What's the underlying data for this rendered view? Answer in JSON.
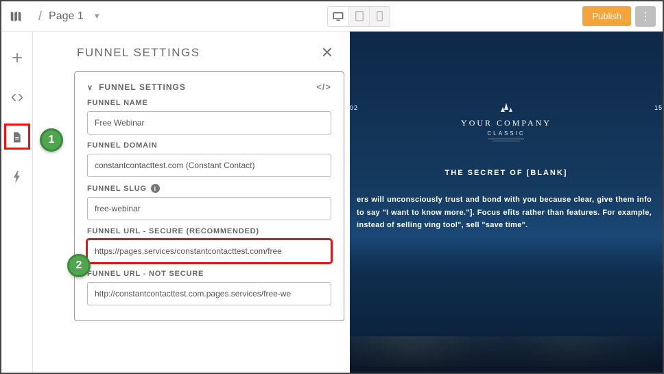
{
  "breadcrumb": {
    "page": "Page 1"
  },
  "topbar": {
    "publish_label": "Publish"
  },
  "panel": {
    "title": "FUNNEL SETTINGS",
    "section_title": "FUNNEL SETTINGS",
    "funnel_name_label": "FUNNEL NAME",
    "funnel_name_value": "Free Webinar",
    "funnel_domain_label": "FUNNEL DOMAIN",
    "funnel_domain_value": "constantcontacttest.com (Constant Contact)",
    "funnel_slug_label": "FUNNEL SLUG",
    "funnel_slug_value": "free-webinar",
    "funnel_url_secure_label": "FUNNEL URL - SECURE (RECOMMENDED)",
    "funnel_url_secure_value": "https://pages.services/constantcontacttest.com/free",
    "funnel_url_notsecure_label": "FUNNEL URL - NOT SECURE",
    "funnel_url_notsecure_value": "http://constantcontacttest.com.pages.services/free-we"
  },
  "callouts": {
    "one": "1",
    "two": "2"
  },
  "preview": {
    "date_left": "02",
    "date_right": "15",
    "company": "YOUR COMPANY",
    "classic": "CLASSIC",
    "secret": "THE SECRET OF [BLANK]",
    "body": "ers will unconsciously trust and bond with you because clear, give them info to say \"I want to know more.\"]. Focus efits rather than features. For example, instead of selling ving tool\", sell \"save time\"."
  }
}
